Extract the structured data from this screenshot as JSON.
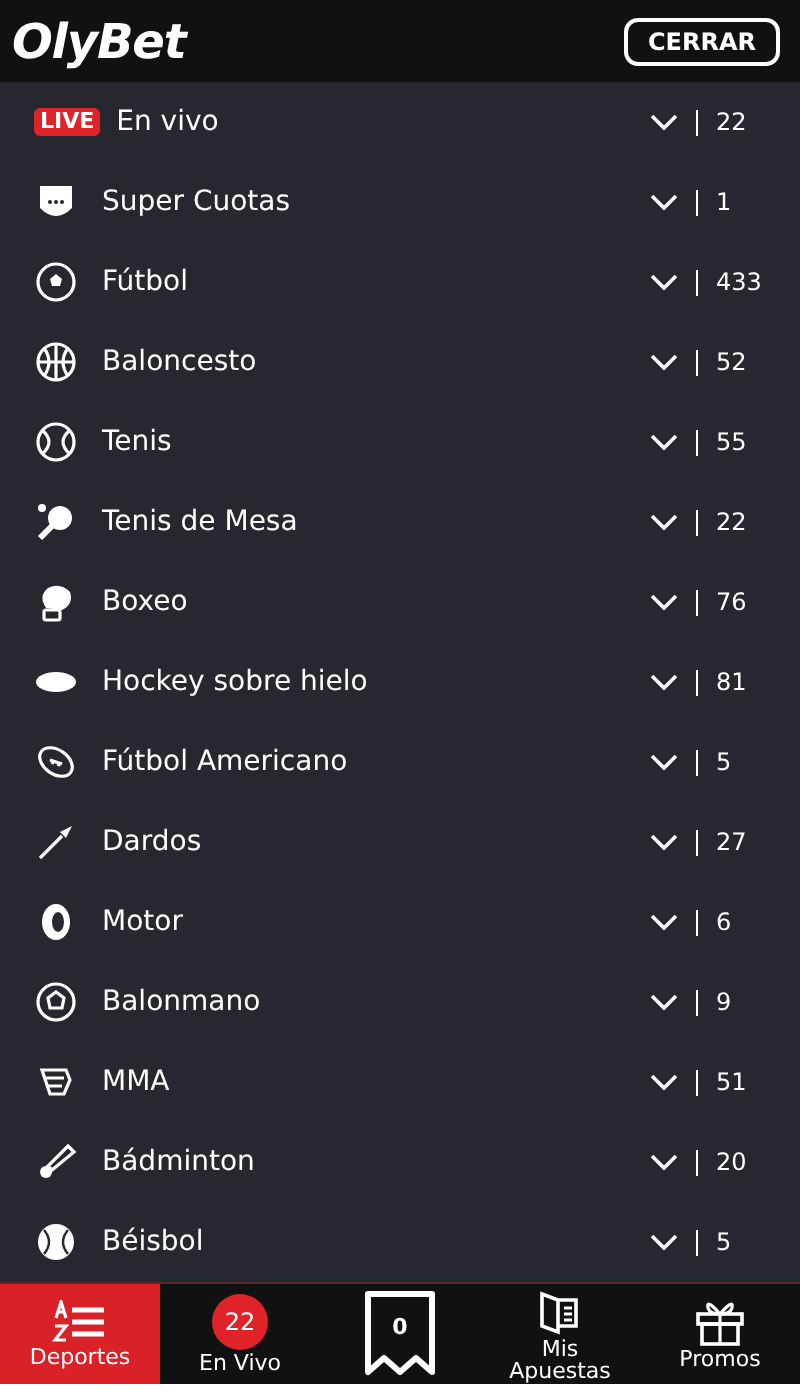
{
  "header": {
    "logo": "OlyBet",
    "close_button": "CERRAR"
  },
  "sports": [
    {
      "kind": "live",
      "badge": "LIVE",
      "label": "En vivo",
      "count": "22"
    },
    {
      "kind": "sport",
      "label": "Super Cuotas",
      "count": "1"
    },
    {
      "kind": "sport",
      "label": "Fútbol",
      "count": "433"
    },
    {
      "kind": "sport",
      "label": "Baloncesto",
      "count": "52"
    },
    {
      "kind": "sport",
      "label": "Tenis",
      "count": "55"
    },
    {
      "kind": "sport",
      "label": "Tenis de Mesa",
      "count": "22"
    },
    {
      "kind": "sport",
      "label": "Boxeo",
      "count": "76"
    },
    {
      "kind": "sport",
      "label": "Hockey sobre hielo",
      "count": "81"
    },
    {
      "kind": "sport",
      "label": "Fútbol Americano",
      "count": "5"
    },
    {
      "kind": "sport",
      "label": "Dardos",
      "count": "27"
    },
    {
      "kind": "sport",
      "label": "Motor",
      "count": "6"
    },
    {
      "kind": "sport",
      "label": "Balonmano",
      "count": "9"
    },
    {
      "kind": "sport",
      "label": "MMA",
      "count": "51"
    },
    {
      "kind": "sport",
      "label": "Bádminton",
      "count": "20"
    },
    {
      "kind": "sport",
      "label": "Béisbol",
      "count": "5"
    }
  ],
  "bottom_nav": [
    {
      "kind": "sports",
      "label": "Deportes",
      "selected": true
    },
    {
      "kind": "live",
      "badge": "22",
      "label": "En Vivo",
      "selected": false
    },
    {
      "kind": "betslip",
      "count": "0",
      "selected": false
    },
    {
      "kind": "bets",
      "label": "Mis Apuestas",
      "selected": false
    },
    {
      "kind": "promos",
      "label": "Promos",
      "selected": false
    }
  ]
}
